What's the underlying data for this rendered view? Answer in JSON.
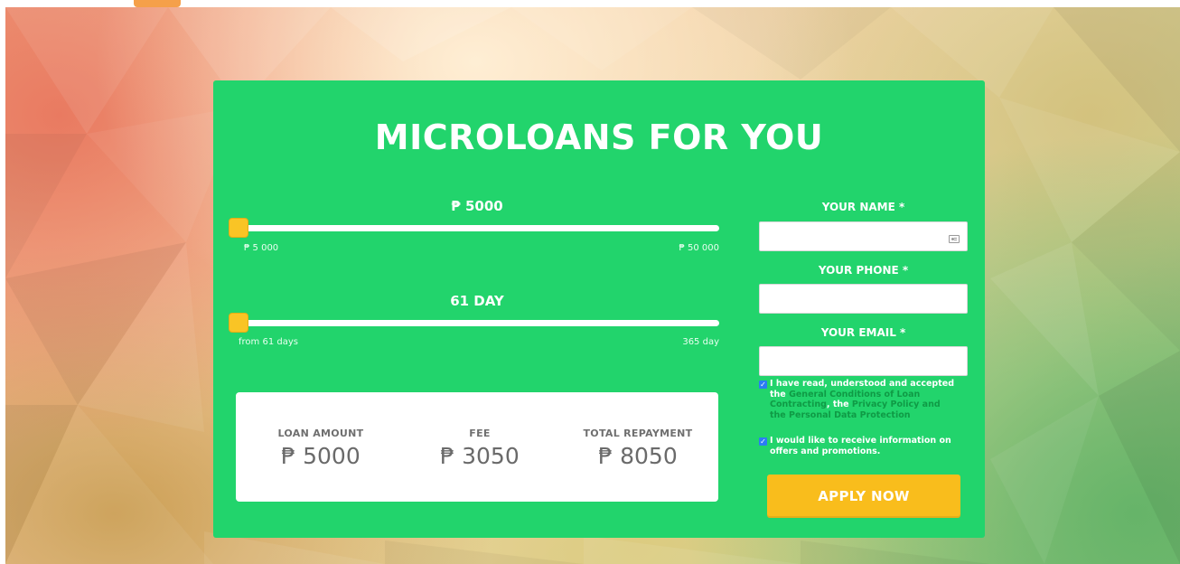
{
  "hero": {
    "title": "MICROLOANS FOR YOU"
  },
  "amount_slider": {
    "value_label": "₱ 5000",
    "min_label": "₱ 5 000",
    "max_label": "₱ 50 000",
    "position_fraction": 0.0
  },
  "term_slider": {
    "value_label": "61 DAY",
    "min_label": "from 61 days",
    "max_label": "365 day",
    "position_fraction": 0.0
  },
  "summary": {
    "loan_amount_label": "LOAN AMOUNT",
    "loan_amount_value": "₱ 5000",
    "fee_label": "FEE",
    "fee_value": "₱ 3050",
    "total_label": "TOTAL REPAYMENT",
    "total_value": "₱ 8050"
  },
  "form": {
    "name_label": "YOUR NAME *",
    "name_value": "",
    "phone_label": "YOUR PHONE *",
    "phone_value": "",
    "email_label": "YOUR EMAIL *",
    "email_value": "",
    "consent_text_1": "I have read, understood and accepted the ",
    "consent_link_1": "General Conditions of Loan Contracting",
    "consent_text_2": ", the ",
    "consent_link_2": "Privacy Policy and the Personal Data Protection",
    "consent_checked": true,
    "promo_text": "I would like to receive information on offers and promotions.",
    "promo_checked": true,
    "apply_label": "APPLY NOW"
  },
  "colors": {
    "card_green": "#22d46c",
    "accent_yellow": "#f9c425",
    "button_yellow": "#f9bd1c",
    "link_green": "#0f9a45",
    "checkbox_blue": "#2b7cf4"
  }
}
